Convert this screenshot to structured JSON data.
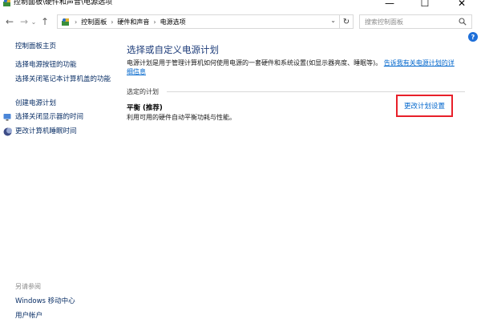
{
  "window": {
    "title": "控制面板\\硬件和声音\\电源选项",
    "minimize": "—",
    "maximize": "☐",
    "close": "✕"
  },
  "nav": {
    "back": "←",
    "forward": "→",
    "recent": "⌄",
    "up": "↑",
    "refresh": "↻",
    "path_dropdown": "⌄"
  },
  "breadcrumb": [
    "控制面板",
    "硬件和声音",
    "电源选项"
  ],
  "breadcrumb_sep": "›",
  "search": {
    "placeholder": "搜索控制面板"
  },
  "help": "?",
  "sidebar": {
    "home": "控制面板主页",
    "items": [
      "选择电源按钮的功能",
      "选择关闭笔记本计算机盖的功能",
      "创建电源计划",
      "选择关闭显示器的时间",
      "更改计算机睡眠时间"
    ],
    "see_also_title": "另请参阅",
    "see_also": [
      "Windows 移动中心",
      "用户帐户"
    ]
  },
  "main": {
    "title": "选择或自定义电源计划",
    "description": "电源计划是用于管理计算机如何使用电源的一套硬件和系统设置(如显示器亮度、睡眠等)。",
    "description_link": "告诉我有关电源计划的详细信息",
    "selected_header": "选定的计划",
    "plan_name": "平衡 (推荐)",
    "plan_description": "利用可用的硬件自动平衡功耗与性能。",
    "change_plan_link": "更改计划设置"
  },
  "colors": {
    "accent": "#0066cc",
    "highlight_box": "#e8202a",
    "title_blue": "#1e3d7a"
  }
}
